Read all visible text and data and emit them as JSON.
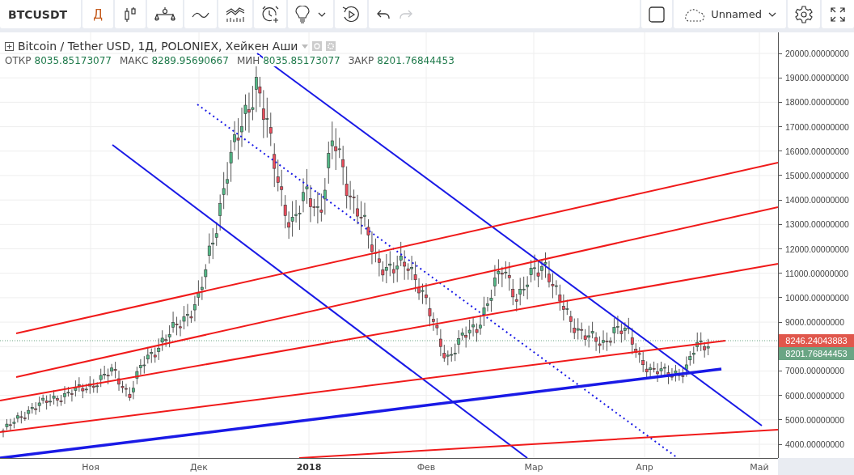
{
  "toolbar": {
    "symbol": "BTCUSDT",
    "interval": "Д",
    "history": [
      {
        "kind": "undo",
        "disabled": false
      },
      {
        "kind": "redo",
        "disabled": true
      }
    ],
    "layout_name": "Unnamed"
  },
  "legend": {
    "title": "Bitcoin / Tether USD, 1Д, POLONIEX, Хейкен Аши",
    "ohlc": [
      {
        "label": "ОТКР",
        "value": "8035.85173077"
      },
      {
        "label": "МАКС",
        "value": "8289.95690667"
      },
      {
        "label": "МИН",
        "value": "8035.85173077"
      },
      {
        "label": "ЗАКР",
        "value": "8201.76844453"
      }
    ]
  },
  "price_axis": {
    "labels": [
      "20000.00000000",
      "19000.00000000",
      "18000.00000000",
      "17000.00000000",
      "16000.00000000",
      "15000.00000000",
      "14000.00000000",
      "13000.00000000",
      "12000.00000000",
      "11000.00000000",
      "10000.00000000",
      "9000.00000000",
      "7000.00000000",
      "6000.00000000",
      "5000.00000000",
      "4000.00000000"
    ],
    "badges": [
      {
        "text": "8246.24043883",
        "color": "#e0574c"
      },
      {
        "text": "8201.76844453",
        "color": "#6aa584"
      }
    ]
  },
  "time_axis": {
    "labels": [
      {
        "text": "Ноя",
        "bold": false
      },
      {
        "text": "Дек",
        "bold": false
      },
      {
        "text": "2018",
        "bold": true
      },
      {
        "text": "Фев",
        "bold": false
      },
      {
        "text": "Мар",
        "bold": false
      },
      {
        "text": "Апр",
        "bold": false
      },
      {
        "text": "Май",
        "bold": false
      }
    ]
  }
}
